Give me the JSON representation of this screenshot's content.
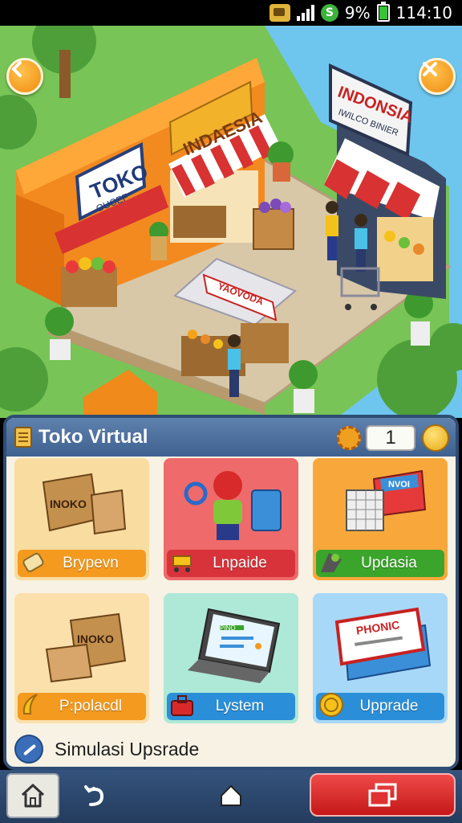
{
  "status_bar": {
    "battery": "9%",
    "time": "114:10"
  },
  "scene": {
    "left_store_sign": "TOKO",
    "left_store_subsign": "OUCEF",
    "center_store_sign": "INDAESIA",
    "right_store_sign": "INDONSIA",
    "right_store_subsign": "IWILCO BINIER",
    "stall_sign": "YAOVODA"
  },
  "panel": {
    "title": "Toko Virtual",
    "level_value": "1",
    "cards": [
      {
        "label": "Brypevn",
        "box_text": "INOKO",
        "color": "#f39a1f"
      },
      {
        "label": "Lnpaide",
        "color": "#d8333a"
      },
      {
        "label": "Updasia",
        "box_text": "NVOI",
        "color": "#3aa52a"
      },
      {
        "label": "P:polacdl",
        "box_text": "INOKO",
        "color": "#f39a1f"
      },
      {
        "label": "Lystem",
        "screen_text": "PINO",
        "color": "#2a8fd8"
      },
      {
        "label": "Upprade",
        "book_text": "PHONIC",
        "color": "#2a8fd8"
      }
    ],
    "footer_text": "Simulasi Upsrade"
  },
  "icons": {
    "back": "back-arrow-icon",
    "close": "close-icon",
    "home": "home-icon",
    "refresh": "refresh-icon",
    "up": "up-arrow-icon",
    "windows": "windows-icon"
  }
}
